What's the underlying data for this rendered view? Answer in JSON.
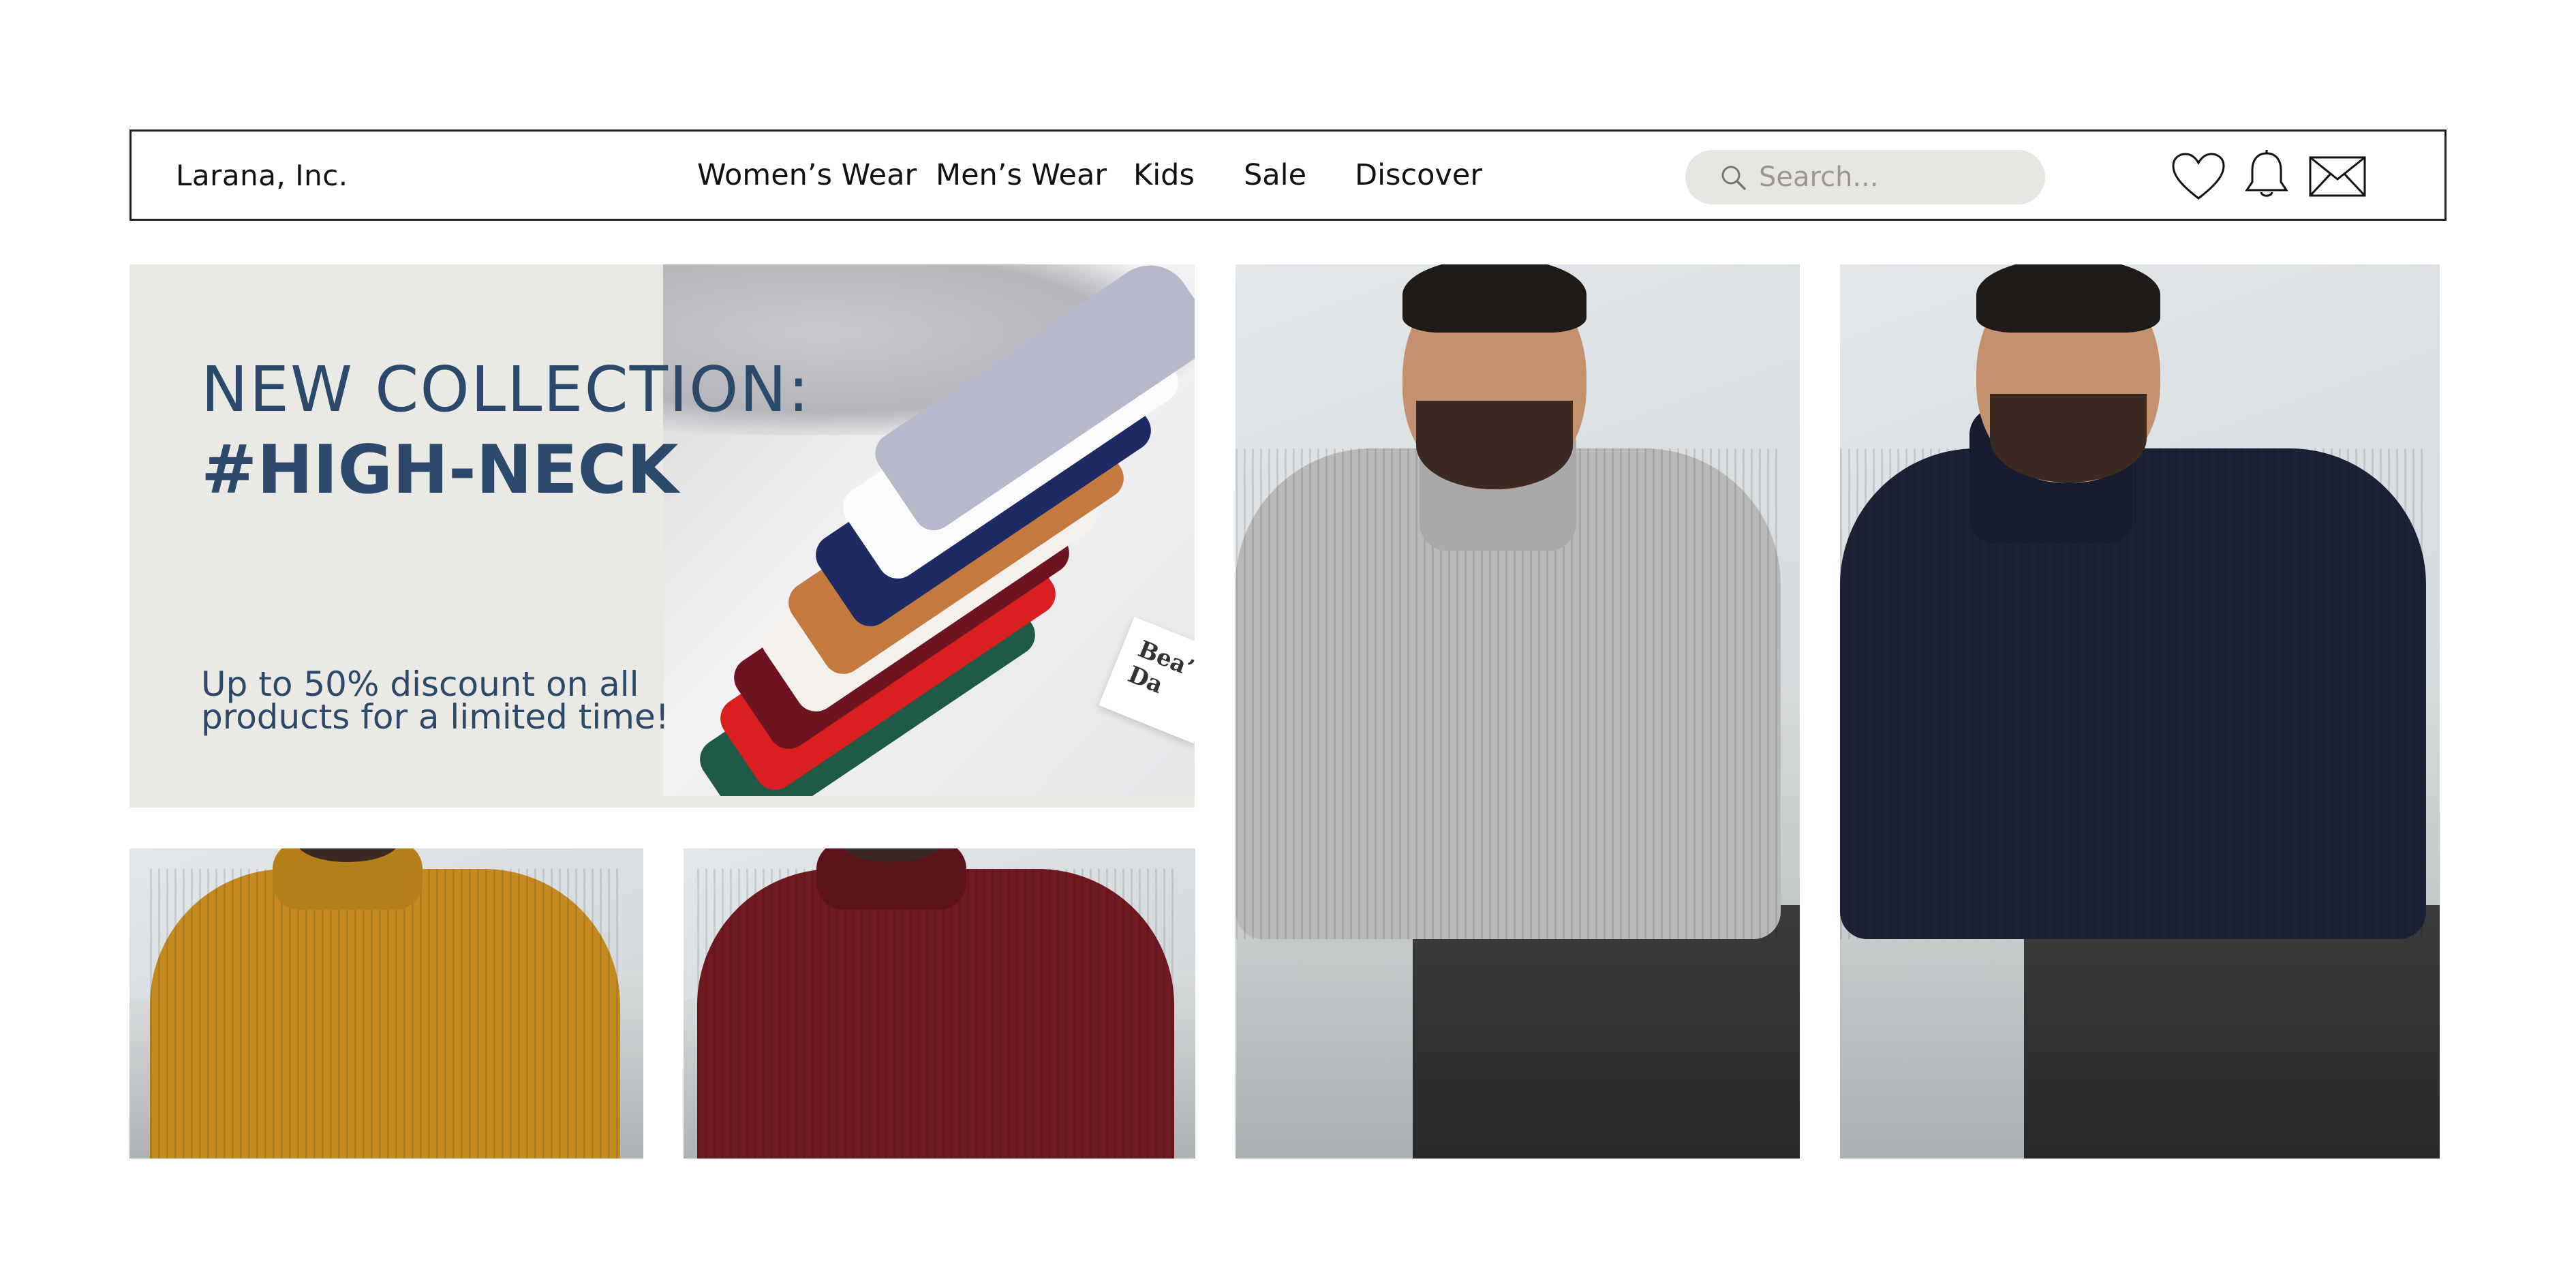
{
  "header": {
    "brand": "Larana, Inc.",
    "menu": [
      "Women’s Wear",
      "Men’s Wear",
      "Kids",
      "Sale",
      "Discover"
    ],
    "search_placeholder": "Search..."
  },
  "icons": {
    "search": "search-icon",
    "wishlist": "heart-icon",
    "notifications": "bell-icon",
    "messages": "mail-icon"
  },
  "hero": {
    "title": "NEW COLLECTION:",
    "tag": "#HIGH-NECK",
    "subtitle": "Up to 50% discount on all products for a limited time!",
    "photo_tag_text": "Bea’ Da"
  },
  "colors": {
    "accent": "#2b4a6b",
    "hero_bg": "#ebe9e4",
    "search_bg": "#e8e6e1",
    "products": {
      "mustard": "#c48a1f",
      "burgundy": "#6e1a20",
      "grey": "#b9b9b9",
      "navy": "#1c2236"
    }
  }
}
